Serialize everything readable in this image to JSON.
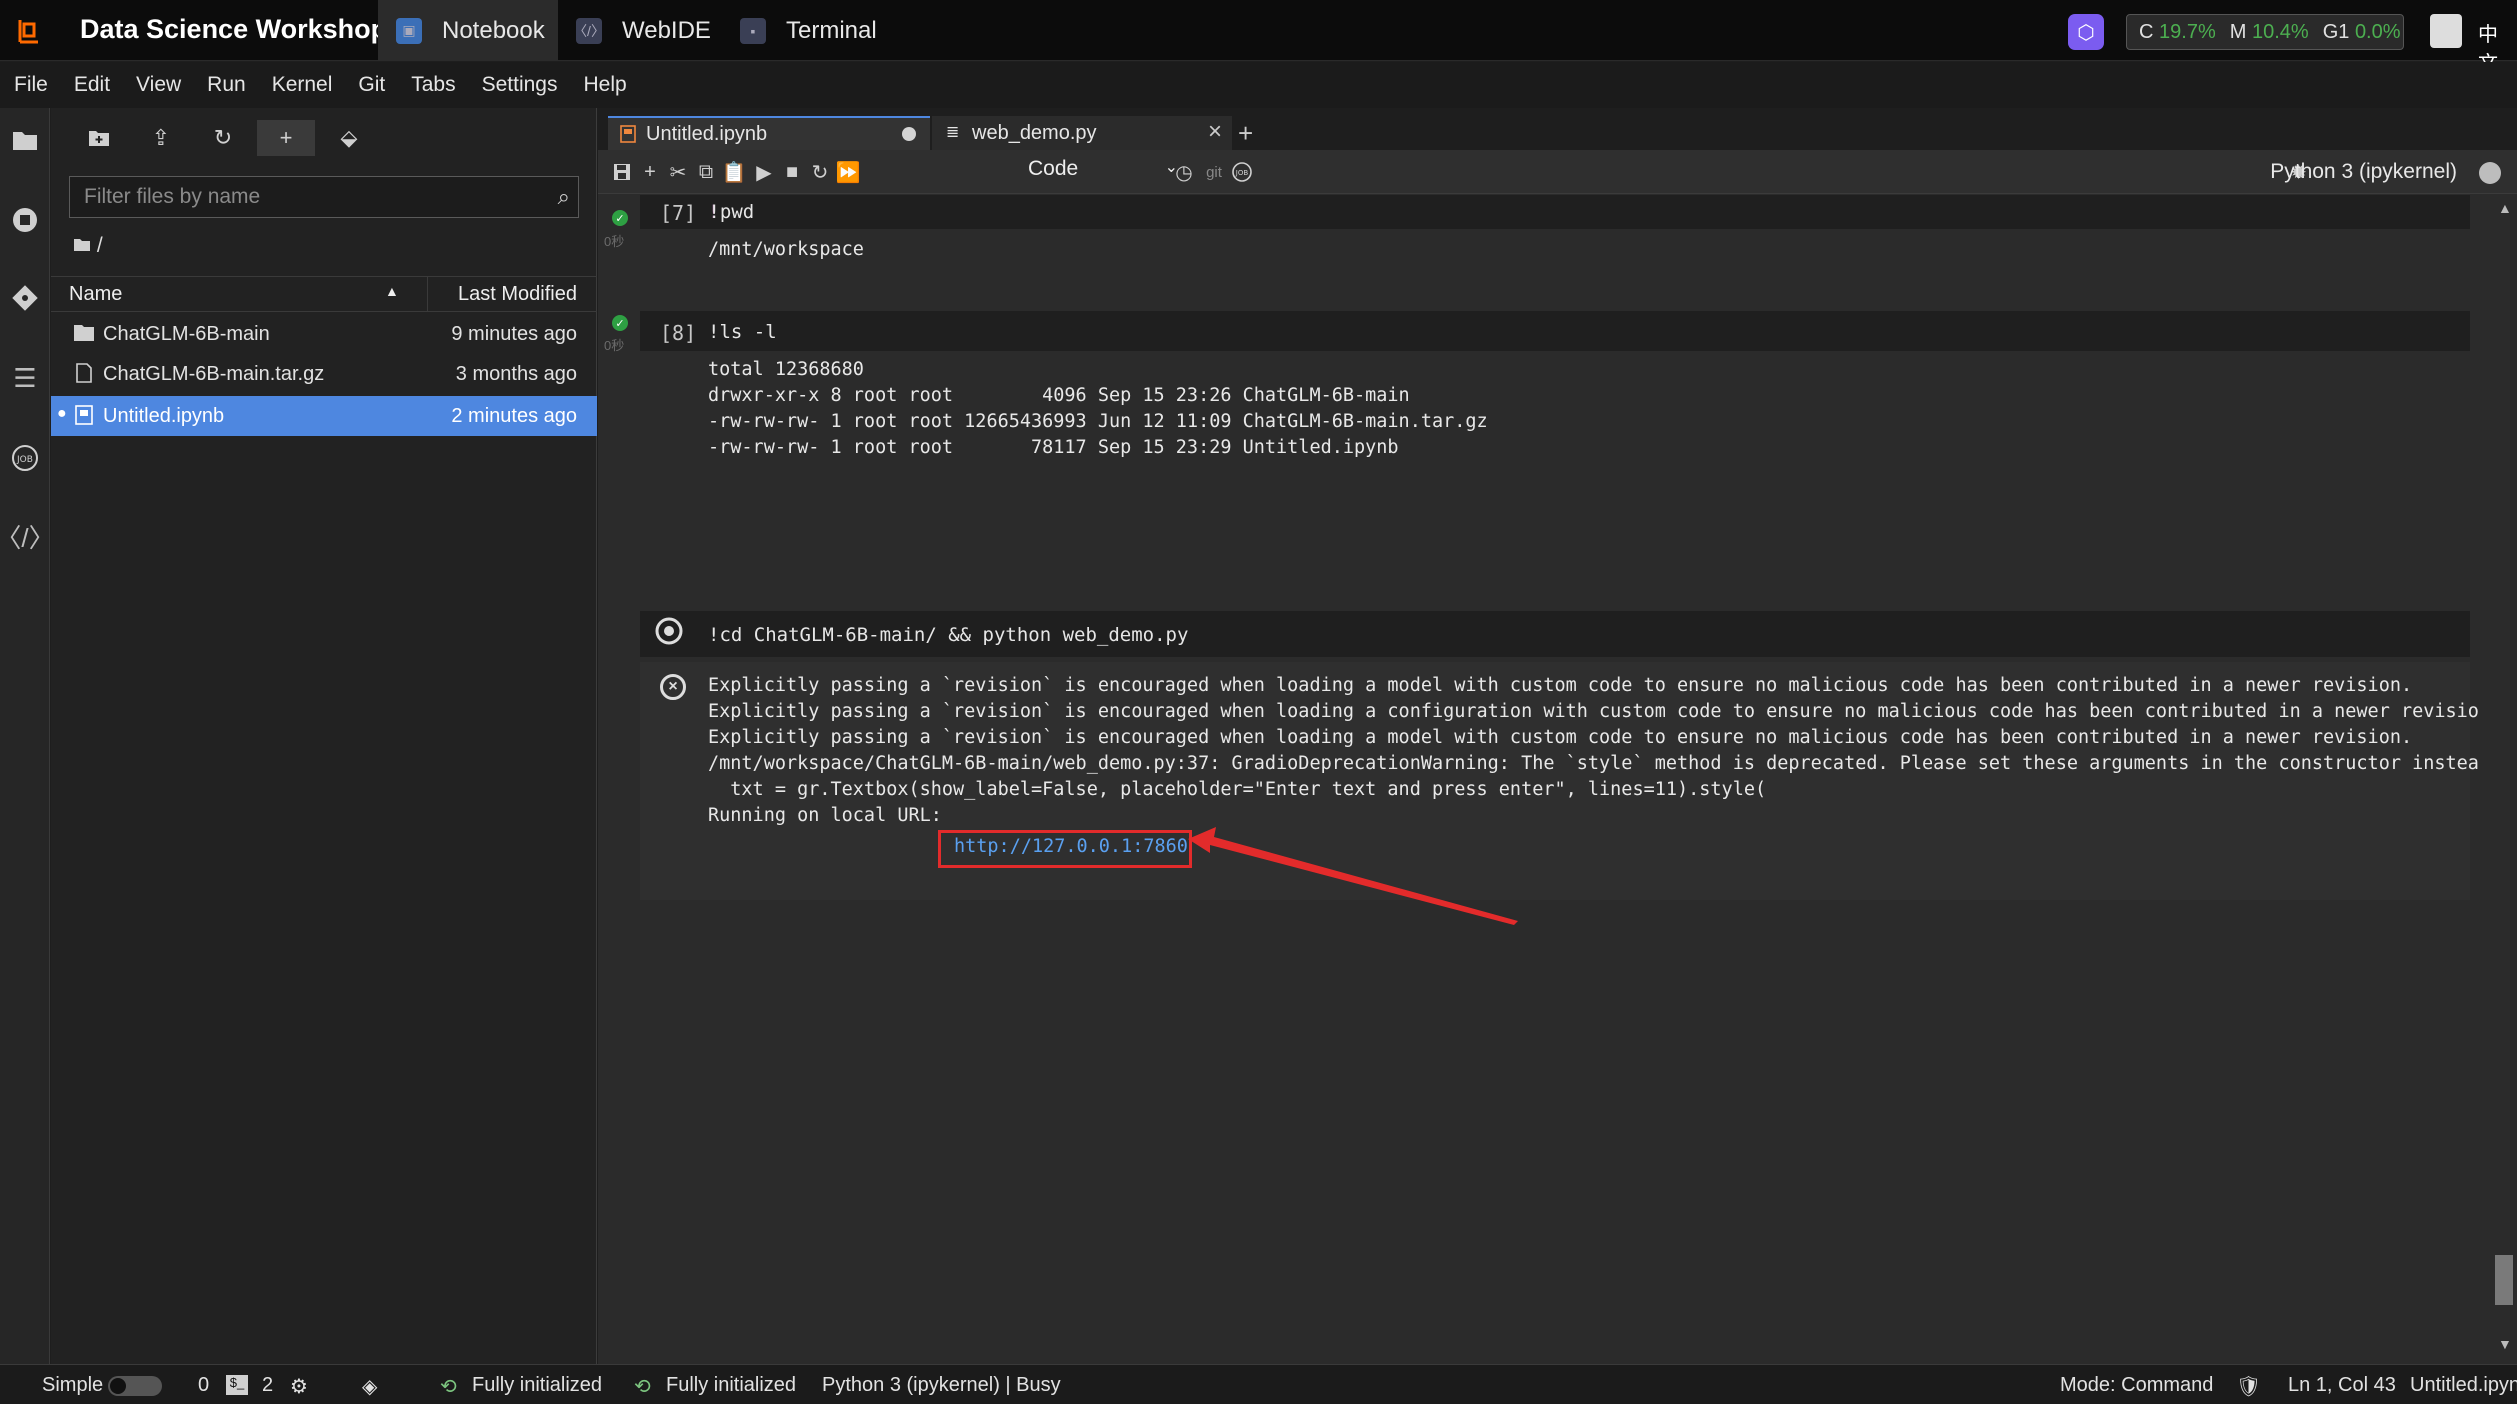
{
  "app": {
    "title": "Data Science Workshop",
    "tabs": [
      "Notebook",
      "WebIDE",
      "Terminal"
    ],
    "resources": {
      "c_label": "C",
      "c_value": "19.7%",
      "m_label": "M",
      "m_value": "10.4%",
      "g_label": "G1",
      "g_value": "0.0%"
    },
    "language": "中文"
  },
  "menu": [
    "File",
    "Edit",
    "View",
    "Run",
    "Kernel",
    "Git",
    "Tabs",
    "Settings",
    "Help"
  ],
  "file_browser": {
    "filter_placeholder": "Filter files by name",
    "breadcrumb": "/",
    "col_name": "Name",
    "col_modified": "Last Modified",
    "files": [
      {
        "name": "ChatGLM-6B-main",
        "modified": "9 minutes ago",
        "type": "folder"
      },
      {
        "name": "ChatGLM-6B-main.tar.gz",
        "modified": "3 months ago",
        "type": "file"
      },
      {
        "name": "Untitled.ipynb",
        "modified": "2 minutes ago",
        "type": "notebook",
        "selected": true
      }
    ]
  },
  "doc_tabs": [
    {
      "label": "Untitled.ipynb",
      "unsaved": true
    },
    {
      "label": "web_demo.py"
    }
  ],
  "notebook_toolbar": {
    "cell_type": "Code",
    "git_label": "git",
    "kernel": "Python 3 (ipykernel)"
  },
  "cells": [
    {
      "prompt": "[7]",
      "source": "!pwd",
      "output": "/mnt/workspace",
      "time": "0秒"
    },
    {
      "prompt": "[8]",
      "source": "!ls -l",
      "output": "total 12368680\ndrwxr-xr-x 8 root root        4096 Sep 15 23:26 ChatGLM-6B-main\n-rw-rw-rw- 1 root root 12665436993 Jun 12 11:09 ChatGLM-6B-main.tar.gz\n-rw-rw-rw- 1 root root       78117 Sep 15 23:29 Untitled.ipynb",
      "time": "0秒"
    },
    {
      "source": "!cd ChatGLM-6B-main/ && python web_demo.py",
      "cell_type": "Code",
      "output": "Explicitly passing a `revision` is encouraged when loading a model with custom code to ensure no malicious code has been contributed in a newer revision.\nExplicitly passing a `revision` is encouraged when loading a configuration with custom code to ensure no malicious code has been contributed in a newer revision.\nExplicitly passing a `revision` is encouraged when loading a model with custom code to ensure no malicious code has been contributed in a newer revision.\n/mnt/workspace/ChatGLM-6B-main/web_demo.py:37: GradioDeprecationWarning: The `style` method is deprecated. Please set these arguments in the constructor instead.\n  txt = gr.Textbox(show_label=False, placeholder=\"Enter text and press enter\", lines=11).style(\nRunning on local URL: ",
      "url": "http://127.0.0.1:7860"
    }
  ],
  "status_bar": {
    "mode_label": "Simple",
    "terminals": "0",
    "kernels": "2",
    "init1": "Fully initialized",
    "init2": "Fully initialized",
    "kernel_status": "Python 3 (ipykernel) | Busy",
    "mode": "Mode: Command",
    "position": "Ln 1, Col 43",
    "file": "Untitled.ipyn"
  },
  "colors": {
    "accent": "#4e87e0",
    "highlight": "#e32b2b",
    "ok": "#2ea043",
    "link": "#5aa0f0"
  }
}
